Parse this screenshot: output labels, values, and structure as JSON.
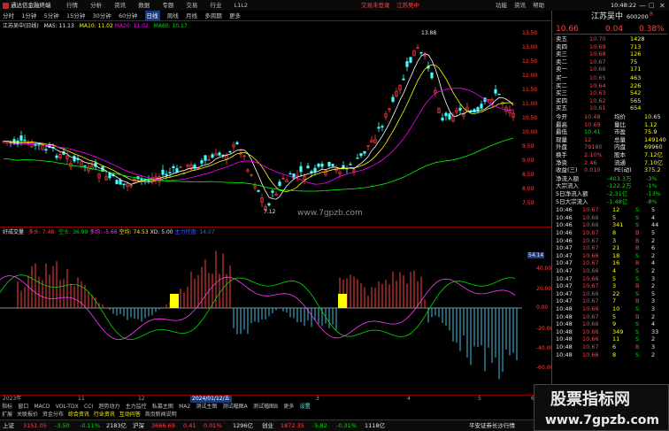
{
  "topbar": {
    "app_name": "通达信金融终端",
    "menus": [
      "行情",
      "分析",
      "资讯",
      "数据",
      "专题",
      "交易",
      "行业",
      "L1L2"
    ],
    "trade_status": "交易未登录",
    "broker": "江苏吴中",
    "right_links": [
      "功能",
      "资讯",
      "帮助"
    ],
    "time": "10:48:22"
  },
  "menu": {
    "items": [
      "分时",
      "1分钟",
      "5分钟",
      "15分钟",
      "30分钟",
      "60分钟",
      "日线",
      "周线",
      "月线",
      "多周期",
      "更多"
    ],
    "active": "日线"
  },
  "chart_header": {
    "stock": "江苏吴中(日线)",
    "ma5": "MA5: 11.13",
    "ma10": "MA10: 11.02",
    "ma20": "MA20: 11.02",
    "ma60": "MA60: 10.17"
  },
  "price_axis": [
    "13.50",
    "13.00",
    "12.50",
    "12.00",
    "11.50",
    "11.00",
    "10.50",
    "10.00",
    "9.50",
    "9.00",
    "8.50",
    "8.00",
    "7.50"
  ],
  "high_label": "13.88",
  "low_label": "7.12",
  "watermark_chart": "www.7gpzb.com",
  "indicator_header": {
    "name": "好成交量",
    "v1": "多头: 7.48",
    "v2": "空头: 36.99",
    "v3": "多均: -5.66",
    "v4": "空均: 74.53",
    "v5": "XD: 5.00",
    "v6": "主力控盘: 14.07"
  },
  "indicator_axis": [
    "54.14",
    "40.00",
    "20.00",
    "0.00",
    "-20.00",
    "-40.00",
    "-60.00"
  ],
  "date_axis": [
    "2023年",
    "11",
    "12",
    "2024/01/12/五",
    "3",
    "4",
    "5",
    "6"
  ],
  "quote": {
    "name": "江苏吴中",
    "code": "600200",
    "flag": "R",
    "price": "10.66",
    "change": "0.04",
    "pct": "0.38%",
    "asks": [
      {
        "label": "卖五",
        "price": "10.70",
        "vol": "1428"
      },
      {
        "label": "卖四",
        "price": "10.69",
        "vol": "713"
      },
      {
        "label": "卖三",
        "price": "10.68",
        "vol": "126"
      },
      {
        "label": "卖二",
        "price": "10.67",
        "vol": "75"
      },
      {
        "label": "卖一",
        "price": "10.66",
        "vol": "171"
      }
    ],
    "bids": [
      {
        "label": "买一",
        "price": "10.65",
        "vol": "463"
      },
      {
        "label": "买二",
        "price": "10.64",
        "vol": "226"
      },
      {
        "label": "买三",
        "price": "10.63",
        "vol": "542"
      },
      {
        "label": "买四",
        "price": "10.62",
        "vol": "565"
      },
      {
        "label": "买五",
        "price": "10.61",
        "vol": "654"
      }
    ],
    "stats": [
      {
        "l1": "今开",
        "v1": "10.48",
        "l2": "均价",
        "v2": "10.65"
      },
      {
        "l1": "最高",
        "v1": "10.69",
        "l2": "量比",
        "v2": "1.12"
      },
      {
        "l1": "最低",
        "v1": "10.41",
        "l2": "市盈",
        "v2": "75.9"
      },
      {
        "l1": "现量",
        "v1": "12",
        "l2": "总量",
        "v2": "149140"
      },
      {
        "l1": "外盘",
        "v1": "79180",
        "l2": "内盘",
        "v2": "69960"
      },
      {
        "l1": "换手",
        "v1": "2.10%",
        "l2": "股本",
        "v2": "7.12亿"
      },
      {
        "l1": "净资",
        "v1": "2.46",
        "l2": "流通",
        "v2": "7.10亿"
      },
      {
        "l1": "收益(三)",
        "v1": "0.010",
        "l2": "PE(动)",
        "v2": "375.2"
      }
    ],
    "flows": [
      {
        "label": "净流入额",
        "v1": "-403.3万",
        "v2": "-3%"
      },
      {
        "label": "大宗流入",
        "v1": "-122.2万",
        "v2": "-1%"
      },
      {
        "label": "5日净流入额",
        "v1": "-2.31亿",
        "v2": "-13%"
      },
      {
        "label": "5日大宗流入",
        "v1": "-1.48亿",
        "v2": "-8%"
      }
    ],
    "ticks": [
      {
        "t": "10:46",
        "p": "10.67",
        "v": "12",
        "d": "S",
        "n": "5"
      },
      {
        "t": "10:46",
        "p": "10.66",
        "v": "5",
        "d": "S",
        "n": "4"
      },
      {
        "t": "10:46",
        "p": "10.66",
        "v": "341",
        "d": "S",
        "n": "44"
      },
      {
        "t": "10:46",
        "p": "10.67",
        "v": "8",
        "d": "B",
        "n": "5"
      },
      {
        "t": "10:46",
        "p": "10.67",
        "v": "3",
        "d": "B",
        "n": "2"
      },
      {
        "t": "10:47",
        "p": "10.67",
        "v": "21",
        "d": "B",
        "n": "6"
      },
      {
        "t": "10:47",
        "p": "10.66",
        "v": "18",
        "d": "S",
        "n": "2"
      },
      {
        "t": "10:47",
        "p": "10.67",
        "v": "16",
        "d": "B",
        "n": "4"
      },
      {
        "t": "10:47",
        "p": "10.66",
        "v": "4",
        "d": "S",
        "n": "2"
      },
      {
        "t": "10:47",
        "p": "10.66",
        "v": "5",
        "d": "S",
        "n": "3"
      },
      {
        "t": "10:47",
        "p": "10.67",
        "v": "3",
        "d": "B",
        "n": "2"
      },
      {
        "t": "10:47",
        "p": "10.66",
        "v": "22",
        "d": "S",
        "n": "5"
      },
      {
        "t": "10:47",
        "p": "10.67",
        "v": "7",
        "d": "B",
        "n": "3"
      },
      {
        "t": "10:48",
        "p": "10.66",
        "v": "10",
        "d": "S",
        "n": "3"
      },
      {
        "t": "10:48",
        "p": "10.67",
        "v": "5",
        "d": "B",
        "n": "2"
      },
      {
        "t": "10:48",
        "p": "10.66",
        "v": "9",
        "d": "S",
        "n": "4"
      },
      {
        "t": "10:48",
        "p": "10.66",
        "v": "349",
        "d": "S",
        "n": "33"
      },
      {
        "t": "10:48",
        "p": "10.66",
        "v": "11",
        "d": "S",
        "n": "2"
      },
      {
        "t": "10:48",
        "p": "10.67",
        "v": "6",
        "d": "B",
        "n": "3"
      },
      {
        "t": "10:48",
        "p": "10.66",
        "v": "8",
        "d": "S",
        "n": "2"
      }
    ]
  },
  "tabs": [
    "指标",
    "窗口",
    "MACD",
    "VOL-TDX",
    "CCI",
    "趋势动力",
    "主力监控",
    "私募主图",
    "MA2",
    "测试主图",
    "测试幅图A",
    "测试幅图B",
    "更多",
    "设置"
  ],
  "tabs2": [
    "扩展",
    "关联报价",
    "资金分布",
    "综合资讯",
    "行业资讯",
    "互动问答",
    "首页新闻说明"
  ],
  "status": {
    "idx1_name": "上证",
    "idx1_val": "3151.05",
    "idx1_chg": "-3.50",
    "idx1_pct": "-0.11%",
    "idx1_amt": "2183亿",
    "idx2_name": "沪深",
    "idx2_val": "3666.69",
    "idx2_chg": "0.41",
    "idx2_pct": "0.01%",
    "idx2_amt": "1296亿",
    "idx3_name": "创业",
    "idx3_val": "1872.35",
    "idx3_chg": "-5.82",
    "idx3_pct": "-0.31%",
    "idx3_amt": "1118亿",
    "broker": "平安证券长沙行情"
  },
  "watermark": {
    "title": "股票指标网",
    "url": "www.7gpzb.com"
  },
  "colors": {
    "up": "#ff4040",
    "down": "#40ffff",
    "ma5": "#ffffff",
    "ma10": "#ffff00",
    "ma20": "#ff00ff",
    "ma60": "#00ff00"
  }
}
